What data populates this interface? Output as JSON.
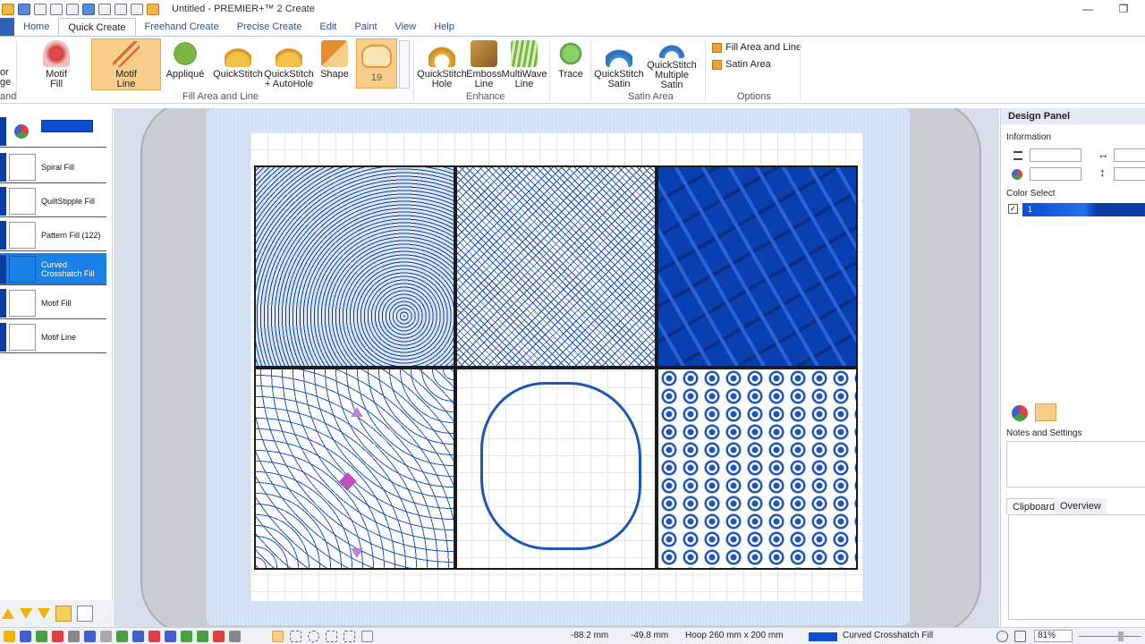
{
  "window": {
    "title": "Untitled - PREMIER+™ 2 Create",
    "minimize": "—",
    "restore": "❐"
  },
  "tabs": [
    "Home",
    "Quick Create",
    "Freehand Create",
    "Precise Create",
    "Edit",
    "Paint",
    "View",
    "Help"
  ],
  "ribbon": {
    "left_cut": {
      "top": "or",
      "mid": "ge",
      "bottom": "and"
    },
    "motif_fill": "Motif Fill",
    "motif_line": "Motif Line",
    "applique": "Appliqué",
    "quickstitch": "QuickStitch",
    "quickstitch_autohole": "QuickStitch + AutoHole",
    "shape": "Shape",
    "shape_size": "19",
    "group_fill_area": "Fill Area and Line",
    "quickstitch_hole": "QuickStitch Hole",
    "emboss_line": "Emboss Line",
    "multiwave_line": "MultiWave Line",
    "group_enhance": "Enhance",
    "trace": "Trace",
    "quickstitch_satin": "QuickStitch Satin",
    "quickstitch_multiple_satin": "QuickStitch Multiple Satin",
    "group_satin_area": "Satin Area",
    "option_fill_area_line": "Fill Area and Line",
    "option_satin_area": "Satin Area",
    "group_options": "Options"
  },
  "objects": [
    {
      "label": "",
      "selected": false
    },
    {
      "label": "Spiral Fill",
      "selected": false
    },
    {
      "label": "QuiltStipple Fill",
      "selected": false
    },
    {
      "label": "Pattern Fill (122)",
      "selected": false
    },
    {
      "label": "Curved Crosshatch Fill",
      "selected": true
    },
    {
      "label": "Motif Fill",
      "selected": false
    },
    {
      "label": "Motif Line",
      "selected": false
    }
  ],
  "design_panel": {
    "title": "Design Panel",
    "information": "Information",
    "color_select": "Color Select",
    "color_1": "1",
    "notes": "Notes and Settings",
    "tab_clipboard": "Clipboard",
    "tab_overview": "Overview"
  },
  "status": {
    "x": "-88.2 mm",
    "y": "-49.8 mm",
    "hoop": "Hoop 260 mm x 200 mm",
    "current_fill": "Curved Crosshatch Fill",
    "zoom": "81%"
  },
  "colors": {
    "accent": "#1a82e6",
    "thread": "#0b3da0",
    "ribbon_active": "#f8ce8a"
  }
}
